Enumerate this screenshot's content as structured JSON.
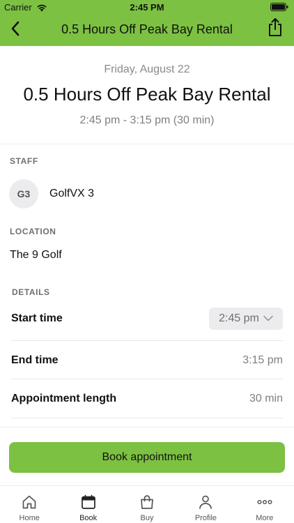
{
  "status_bar": {
    "carrier": "Carrier",
    "time": "2:45 PM"
  },
  "navbar": {
    "title": "0.5 Hours Off Peak Bay Rental",
    "background": "#7cc142",
    "back_icon": "chevron-left-icon",
    "share_icon": "share-icon"
  },
  "summary": {
    "date": "Friday, August 22",
    "title": "0.5 Hours Off Peak Bay Rental",
    "time_range": "2:45 pm - 3:15 pm (30 min)"
  },
  "staff": {
    "section_label": "STAFF",
    "avatar_initials": "G3",
    "name": "GolfVX 3"
  },
  "location": {
    "section_label": "LOCATION",
    "name": "The 9 Golf"
  },
  "details": {
    "section_label": "DETAILS",
    "start_time_label": "Start time",
    "start_time_value": "2:45 pm",
    "end_time_label": "End time",
    "end_time_value": "3:15 pm",
    "length_label": "Appointment length",
    "length_value": "30 min"
  },
  "actions": {
    "book_label": "Book appointment",
    "accent": "#7cc142"
  },
  "tabbar": {
    "active": "Book",
    "tabs": [
      {
        "label": "Home",
        "icon": "home-icon"
      },
      {
        "label": "Book",
        "icon": "calendar-icon"
      },
      {
        "label": "Buy",
        "icon": "shopping-bag-icon"
      },
      {
        "label": "Profile",
        "icon": "person-icon"
      },
      {
        "label": "More",
        "icon": "more-dots-icon"
      }
    ]
  }
}
